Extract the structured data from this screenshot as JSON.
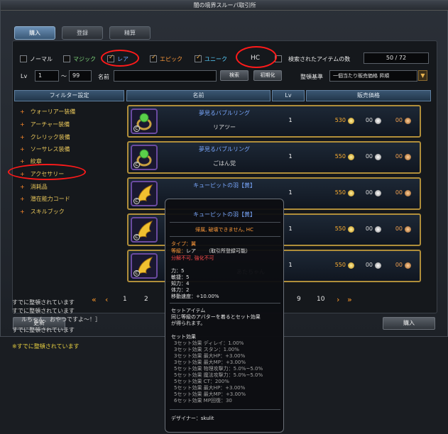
{
  "window": {
    "title": "闇の境界スルーパ取引所"
  },
  "tabs": [
    "購入",
    "登録",
    "精算"
  ],
  "filters": {
    "checkboxes": [
      {
        "label": "ノーマル",
        "checked": false,
        "color": "white"
      },
      {
        "label": "マジック",
        "checked": false,
        "color": "green"
      },
      {
        "label": "レア",
        "checked": true,
        "color": "blue"
      },
      {
        "label": "エピック",
        "checked": true,
        "color": "orange"
      },
      {
        "label": "ユニーク",
        "checked": true,
        "color": "cyan"
      }
    ],
    "hc_label": "HC",
    "lv_label": "Lv",
    "lv_min": "1",
    "lv_sep": "〜",
    "lv_max": "99",
    "name_label": "名前",
    "search_button": "検索",
    "reset_button": "初期化",
    "result_label": "検索されたアイテムの数",
    "result_value": "50 / 72",
    "sort_label": "整頓基準",
    "sort_value": "一個当たり販売価格 昇順"
  },
  "columns": {
    "filter": "フィルター設定",
    "name": "名前",
    "lv": "Lv",
    "price": "販売価格"
  },
  "categories": [
    "ウォーリアー装備",
    "アーチャー装備",
    "クレリック装備",
    "ソーサレス装備",
    "紋章",
    "アクセサリー",
    "消耗品",
    "潜在能力コード",
    "スキルブック"
  ],
  "items": [
    {
      "name": "夢見るバブルリング",
      "seller": "リアツー",
      "lv": "1",
      "gold": "530",
      "silver": "00",
      "copper": "00",
      "icon": "ring-icon"
    },
    {
      "name": "夢見るバブルリング",
      "seller": "ごはん党",
      "lv": "1",
      "gold": "550",
      "silver": "00",
      "copper": "00",
      "icon": "ring-icon"
    },
    {
      "name": "キューピットの羽【黄】",
      "seller": "",
      "lv": "1",
      "gold": "550",
      "silver": "00",
      "copper": "00",
      "icon": "wing-icon"
    },
    {
      "name": "",
      "seller": "",
      "lv": "1",
      "gold": "550",
      "silver": "00",
      "copper": "00",
      "icon": "wing-icon"
    },
    {
      "name": "",
      "seller": "あたちゃん",
      "lv": "1",
      "gold": "550",
      "silver": "00",
      "copper": "00",
      "icon": "wing-icon"
    }
  ],
  "pager": {
    "pages_left": [
      "1",
      "2"
    ],
    "pages_right": [
      "9",
      "10"
    ]
  },
  "buttons": {
    "refresh": "更新",
    "buy": "購入"
  },
  "chat": [
    {
      "text": "すでに整頓されています",
      "color": "#9aa0a6"
    },
    {
      "text": "すでに整頓されています",
      "color": "#9aa0a6"
    },
    {
      "text": "ルちゃん、おやつですよ〜！］",
      "color": "#9aa0a6"
    },
    {
      "text": "すでに整頓されています",
      "color": "#9aa0a6"
    },
    {
      "text": "※すでに整頓されています",
      "color": "#e8d040"
    }
  ],
  "tooltip": {
    "title": "キューピットの羽【黄】",
    "bind": "帰属, 破壊できません, HC",
    "type_line": "タイプ：翼",
    "grade_label": "等級：",
    "grade_value": "レア",
    "grade_note": "（取引所登録可能）",
    "no_disassemble": "分解不可, 強化不可",
    "stats": [
      "力：5",
      "敏捷：5",
      "知力：4",
      "体力：2",
      "移動速度：+10.00%"
    ],
    "set_header": "セットアイテム",
    "set_desc_1": "同じ等級のアバターを着るとセット効果",
    "set_desc_2": "が得られます。",
    "effect_header": "セット効果",
    "effects": [
      "3セット効果 ディレイ：1.00%",
      "3セット効果 スタン：1.00%",
      "3セット効果 最大HP：+3.00%",
      "3セット効果 最大MP：+3.00%",
      "5セット効果 物理攻撃力：5.0%~5.0%",
      "5セット効果 魔法攻撃力：5.0%~5.0%",
      "5セット効果 CT：200%",
      "5セット効果 最大HP：+3.00%",
      "5セット効果 最大MP：+3.00%",
      "6セット効果 MP回復：30"
    ],
    "designer": "デザイナー：skulit"
  }
}
